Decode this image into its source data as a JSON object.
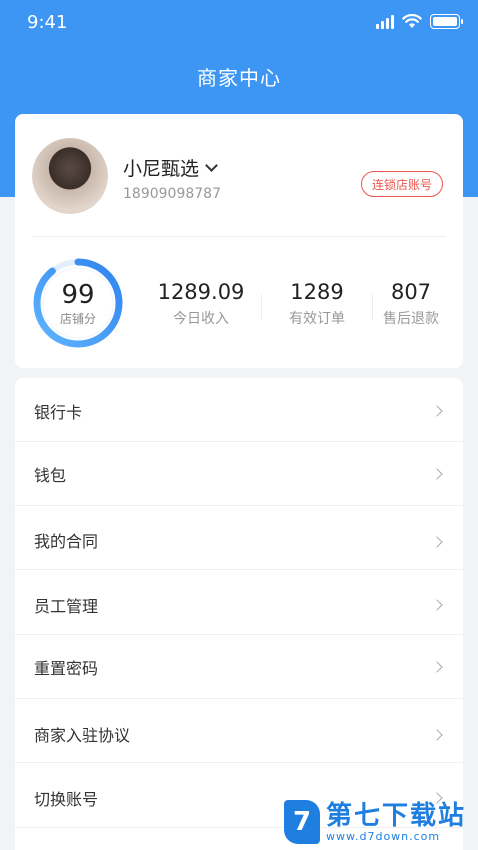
{
  "status_bar": {
    "time": "9:41"
  },
  "header": {
    "title": "商家中心",
    "background_color": "#3d96f4"
  },
  "profile": {
    "shop_name": "小尼甄选",
    "phone": "18909098787",
    "chain_badge": "连锁店账号",
    "badge_color": "#e8574e"
  },
  "stats": {
    "score": {
      "value": "99",
      "label": "店铺分",
      "fraction": 0.99
    },
    "items": [
      {
        "value": "1289.09",
        "label": "今日收入"
      },
      {
        "value": "1289",
        "label": "有效订单"
      },
      {
        "value": "807",
        "label": "售后退款"
      }
    ]
  },
  "menu": {
    "items": [
      {
        "label": "银行卡"
      },
      {
        "label": "钱包"
      },
      {
        "label": "我的合同"
      },
      {
        "label": "员工管理"
      },
      {
        "label": "重置密码"
      },
      {
        "label": "商家入驻协议"
      },
      {
        "label": "切换账号"
      }
    ]
  },
  "watermark": {
    "logo_char": "7",
    "name": "第七下载站",
    "url": "www.d7down.com"
  }
}
